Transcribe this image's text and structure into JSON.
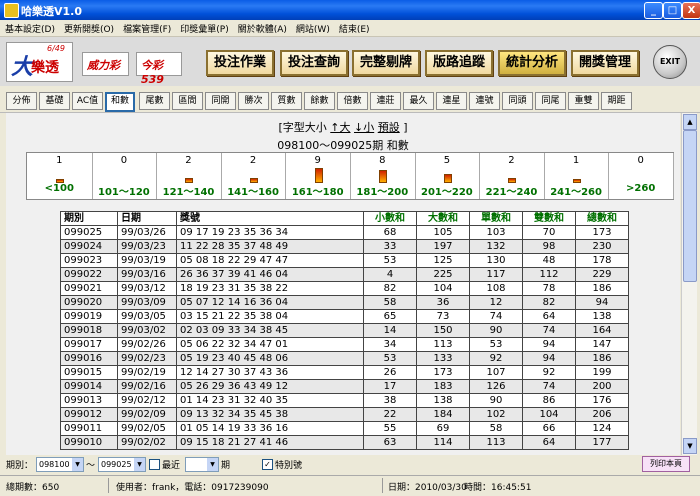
{
  "window": {
    "title": "哈樂透V1.0",
    "min": "_",
    "max": "□",
    "close": "X"
  },
  "menu": [
    "基本設定(D)",
    "更新開獎(O)",
    "檔案管理(F)",
    "印獎彙單(P)",
    "關於軟體(A)",
    "網站(W)",
    "結束(E)"
  ],
  "logos": {
    "lotto": "樂透",
    "lotto_big": "大",
    "lotto_num": "6/49",
    "power": "威力彩",
    "daily": "今彩539"
  },
  "main_buttons": [
    {
      "label": "投注作業"
    },
    {
      "label": "投注查詢"
    },
    {
      "label": "完整剔牌"
    },
    {
      "label": "版路追蹤"
    },
    {
      "label": "統計分析"
    },
    {
      "label": "開獎管理"
    }
  ],
  "exit_label": "EXIT",
  "toolbar": [
    "分佈",
    "基礎",
    "AC值",
    "和數",
    "尾數",
    "區間",
    "同開",
    "勝次",
    "質數",
    "餘數",
    "倍數",
    "連莊",
    "最久",
    "連星",
    "連號",
    "同頭",
    "同尾",
    "重雙",
    "期距"
  ],
  "font_ctrl": {
    "open": "[",
    "label": "字型大小",
    "up": "↑大",
    "down": "↓小",
    "preset": "預設",
    "close": "]"
  },
  "period_title": "098100～099025期 和數",
  "ranges": [
    {
      "count": "1",
      "count_val": 1,
      "label": "<100"
    },
    {
      "count": "0",
      "count_val": 0,
      "label": "101～120"
    },
    {
      "count": "2",
      "count_val": 2,
      "label": "121～140"
    },
    {
      "count": "2",
      "count_val": 2,
      "label": "141～160"
    },
    {
      "count": "9",
      "count_val": 9,
      "label": "161～180"
    },
    {
      "count": "8",
      "count_val": 8,
      "label": "181～200"
    },
    {
      "count": "5",
      "count_val": 5,
      "label": "201～220"
    },
    {
      "count": "2",
      "count_val": 2,
      "label": "221～240"
    },
    {
      "count": "1",
      "count_val": 1,
      "label": "241～260"
    },
    {
      "count": "0",
      "count_val": 0,
      "label": ">260"
    }
  ],
  "table_headers": [
    "期別",
    "日期",
    "獎號",
    "小數和",
    "大數和",
    "單數和",
    "雙數和",
    "總數和"
  ],
  "rows": [
    [
      "099025",
      "99/03/26",
      "09 17 19 23 35 36 34",
      "68",
      "105",
      "103",
      "70",
      "173"
    ],
    [
      "099024",
      "99/03/23",
      "11 22 28 35 37 48 49",
      "33",
      "197",
      "132",
      "98",
      "230"
    ],
    [
      "099023",
      "99/03/19",
      "05 08 18 22 29 47 47",
      "53",
      "125",
      "130",
      "48",
      "178"
    ],
    [
      "099022",
      "99/03/16",
      "26 36 37 39 41 46 04",
      "4",
      "225",
      "117",
      "112",
      "229"
    ],
    [
      "099021",
      "99/03/12",
      "18 19 23 31 35 38 22",
      "82",
      "104",
      "108",
      "78",
      "186"
    ],
    [
      "099020",
      "99/03/09",
      "05 07 12 14 16 36 04",
      "58",
      "36",
      "12",
      "82",
      "94"
    ],
    [
      "099019",
      "99/03/05",
      "03 15 21 22 35 38 04",
      "65",
      "73",
      "74",
      "64",
      "138"
    ],
    [
      "099018",
      "99/03/02",
      "02 03 09 33 34 38 45",
      "14",
      "150",
      "90",
      "74",
      "164"
    ],
    [
      "099017",
      "99/02/26",
      "05 06 22 32 34 47 01",
      "34",
      "113",
      "53",
      "94",
      "147"
    ],
    [
      "099016",
      "99/02/23",
      "05 19 23 40 45 48 06",
      "53",
      "133",
      "92",
      "94",
      "186"
    ],
    [
      "099015",
      "99/02/19",
      "12 14 27 30 37 43 36",
      "26",
      "173",
      "107",
      "92",
      "199"
    ],
    [
      "099014",
      "99/02/16",
      "05 26 29 36 43 49 12",
      "17",
      "183",
      "126",
      "74",
      "200"
    ],
    [
      "099013",
      "99/02/12",
      "01 14 23 31 32 40 35",
      "38",
      "138",
      "90",
      "86",
      "176"
    ],
    [
      "099012",
      "99/02/09",
      "09 13 32 34 35 45 38",
      "22",
      "184",
      "102",
      "104",
      "206"
    ],
    [
      "099011",
      "99/02/05",
      "01 05 14 19 33 36 16",
      "55",
      "69",
      "58",
      "66",
      "124"
    ],
    [
      "099010",
      "99/02/02",
      "09 15 18 21 27 41 46",
      "63",
      "114",
      "113",
      "64",
      "177"
    ]
  ],
  "filter": {
    "period_label": "期別：",
    "from": "098100",
    "tilde": "～",
    "to": "099025",
    "recent_label": "最近",
    "unit": "期",
    "special_label": "特別號",
    "special_checked": "✓",
    "print": "列印本頁"
  },
  "status": {
    "total": "總期數：650",
    "user": "使用者：frank，電話：0917239090",
    "date": "日期：2010/03/30",
    "time": "時間：16:45:51"
  }
}
